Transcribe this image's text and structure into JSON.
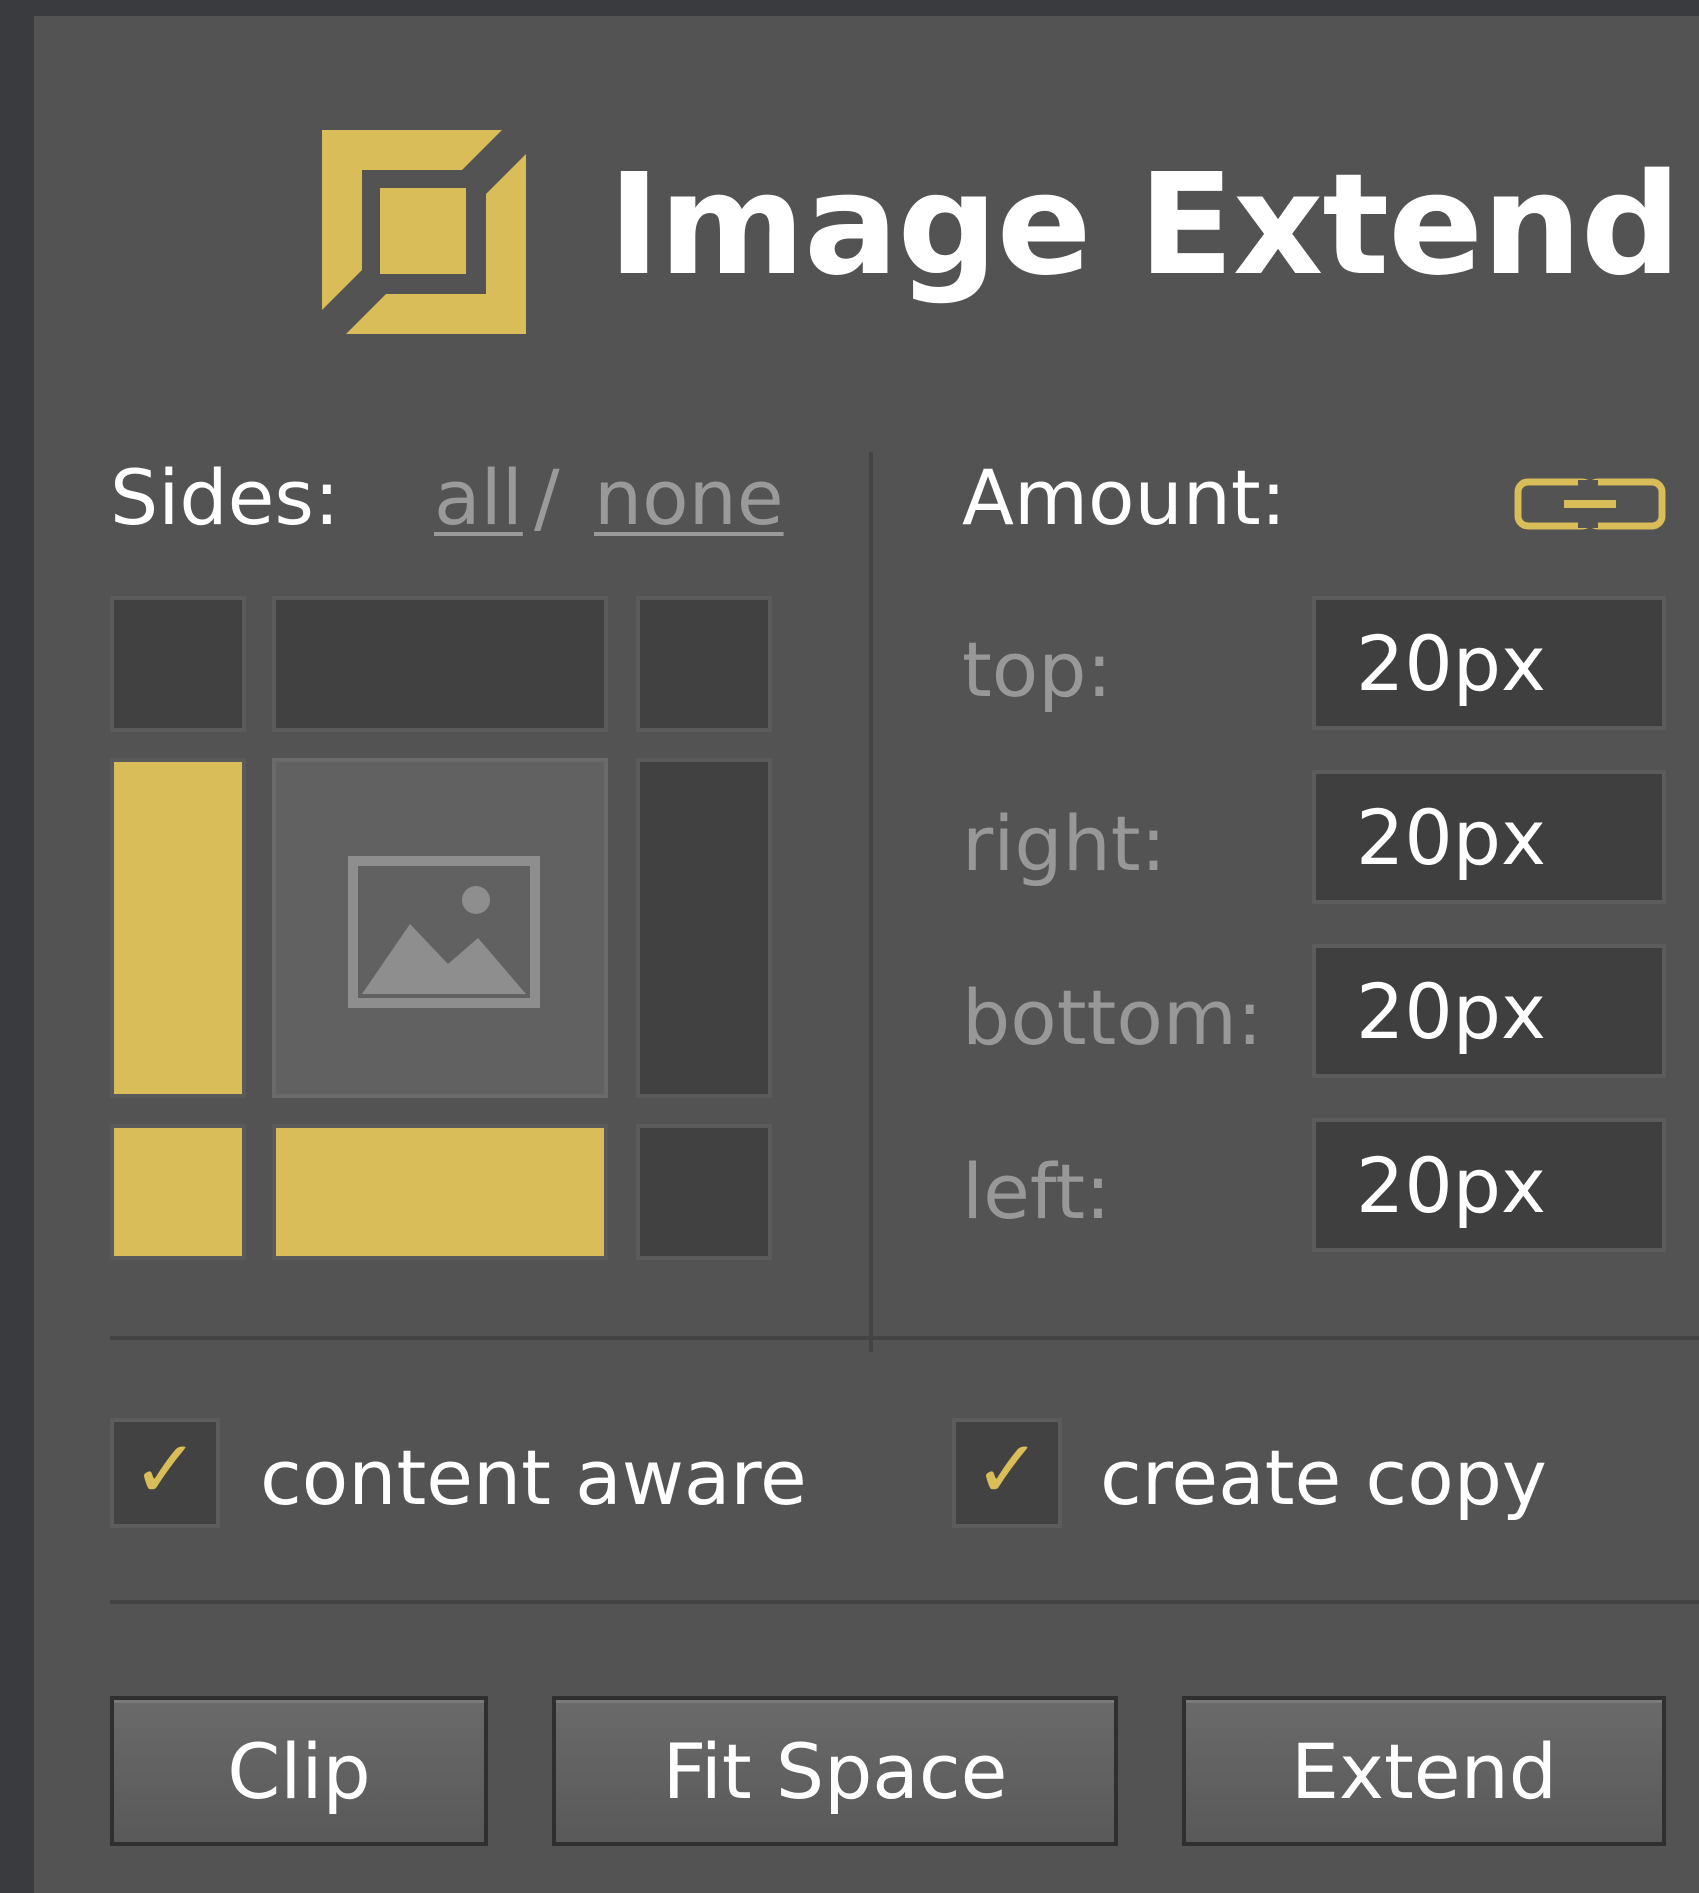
{
  "app": {
    "title": "Image Extend",
    "logo_icon": "frame-extend-icon",
    "accent_color": "#d9bd58"
  },
  "sides": {
    "label": "Sides:",
    "all_link": "all",
    "separator": "/",
    "none_link": "none",
    "selected": {
      "top_left": false,
      "top": false,
      "top_right": false,
      "left": true,
      "right": false,
      "bottom_left": true,
      "bottom": true,
      "bottom_right": false
    },
    "center_icon": "image-placeholder-icon"
  },
  "amount": {
    "label": "Amount:",
    "link_icon": "link-chain-icon",
    "fields": {
      "top": {
        "label": "top:",
        "value": "20px"
      },
      "right": {
        "label": "right:",
        "value": "20px"
      },
      "bottom": {
        "label": "bottom:",
        "value": "20px"
      },
      "left": {
        "label": "left:",
        "value": "20px"
      }
    }
  },
  "options": {
    "content_aware": {
      "label": "content aware",
      "checked": true
    },
    "create_copy": {
      "label": "create copy",
      "checked": true
    },
    "check_glyph": "✓"
  },
  "actions": {
    "clip": "Clip",
    "fit_space": "Fit Space",
    "extend": "Extend"
  }
}
